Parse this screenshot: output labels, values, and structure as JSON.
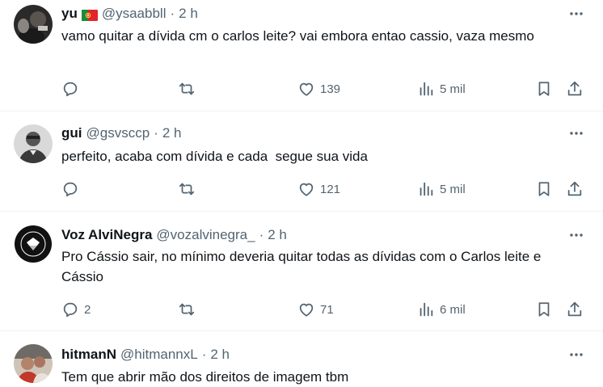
{
  "tweets": [
    {
      "name": "yu",
      "has_flag": true,
      "handle": "@ysaabbll",
      "separator": "·",
      "time": "2 h",
      "text": "vamo quitar a dívida cm o carlos leite? vai embora entao cassio, vaza mesmo",
      "replies": "",
      "likes": "139",
      "views": "5 mil"
    },
    {
      "name": "gui",
      "has_flag": false,
      "handle": "@gsvsccp",
      "separator": "·",
      "time": "2 h",
      "text": "perfeito, acaba com dívida e cada  segue sua vida",
      "replies": "",
      "likes": "121",
      "views": "5 mil"
    },
    {
      "name": "Voz AlviNegra",
      "has_flag": false,
      "handle": "@vozalvinegra_",
      "separator": "·",
      "time": "2 h",
      "text": "Pro Cássio sair, no mínimo deveria quitar todas as dívidas com o Carlos leite e Cássio",
      "replies": "2",
      "likes": "71",
      "views": "6 mil"
    },
    {
      "name": "hitmanN",
      "has_flag": false,
      "handle": "@hitmannxL",
      "separator": "·",
      "time": "2 h",
      "text": "Tem que abrir mão dos direitos de imagem tbm",
      "replies": "",
      "likes": "",
      "views": ""
    }
  ],
  "icons": {
    "more": "more-horizontal-icon",
    "reply": "reply-icon",
    "retweet": "retweet-icon",
    "like": "like-icon",
    "views": "views-icon",
    "bookmark": "bookmark-icon",
    "share": "share-icon"
  },
  "colors": {
    "text": "#0f1419",
    "secondary": "#536471",
    "divider": "#eff3f4"
  }
}
